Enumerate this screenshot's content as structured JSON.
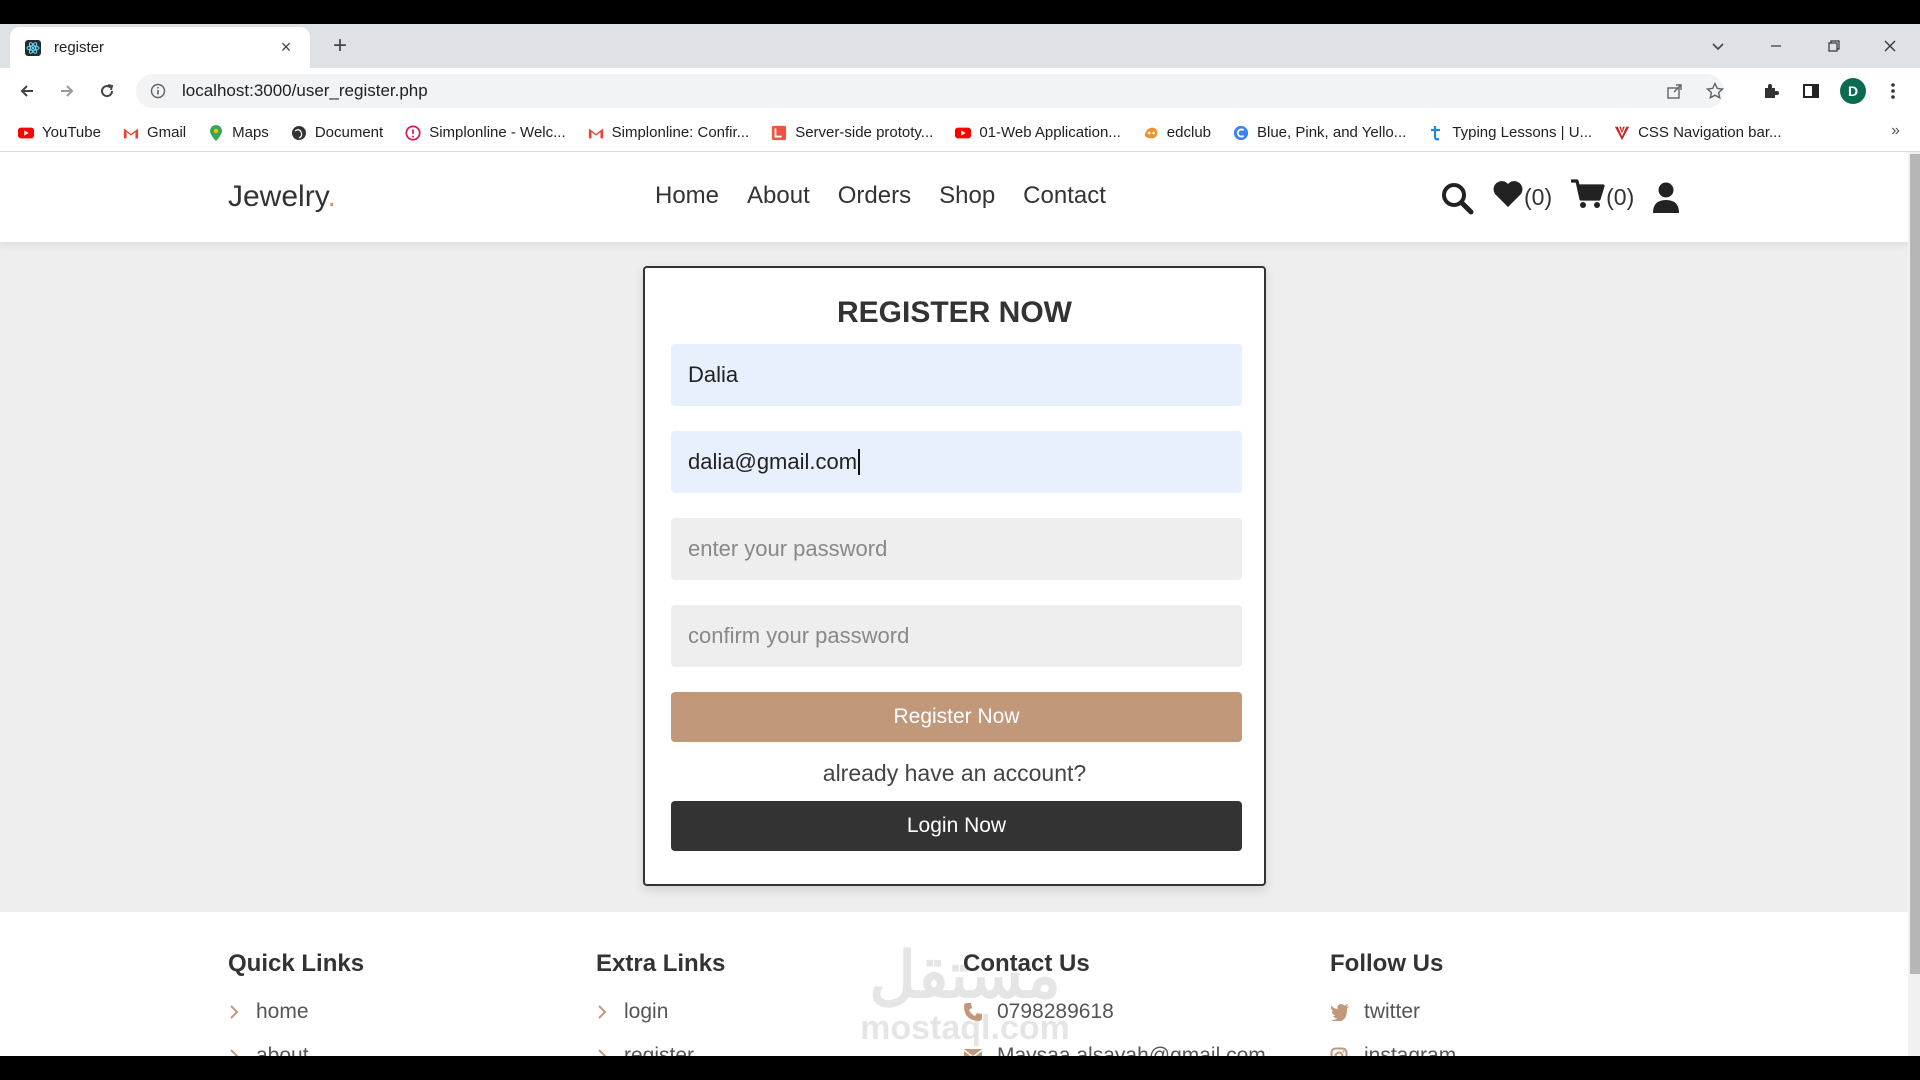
{
  "browser": {
    "tab_title": "register",
    "tab_close": "×",
    "new_tab": "+",
    "url": "localhost:3000/user_register.php",
    "profile_initial": "D",
    "bookmarks": [
      {
        "label": "YouTube",
        "icon": "youtube-icon",
        "color": "#ff0000"
      },
      {
        "label": "Gmail",
        "icon": "gmail-icon",
        "color": "#ea4335"
      },
      {
        "label": "Maps",
        "icon": "maps-icon",
        "color": "#34a853"
      },
      {
        "label": "Document",
        "icon": "globe-icon",
        "color": "#333333"
      },
      {
        "label": "Simplonline - Welc...",
        "icon": "simplon-icon",
        "color": "#d81b60"
      },
      {
        "label": "Simplonline: Confir...",
        "icon": "gmail-icon",
        "color": "#ea4335"
      },
      {
        "label": "Server-side prototy...",
        "icon": "laravel-icon",
        "color": "#f05340"
      },
      {
        "label": "01-Web Application...",
        "icon": "youtube-icon",
        "color": "#ff0000"
      },
      {
        "label": "edclub",
        "icon": "edclub-icon",
        "color": "#f0932b"
      },
      {
        "label": "Blue, Pink, and Yello...",
        "icon": "canva-icon",
        "color": "#3b82f6"
      },
      {
        "label": "Typing Lessons | U...",
        "icon": "typing-icon",
        "color": "#1e88e5"
      },
      {
        "label": "CSS Navigation bar...",
        "icon": "vivaldi-icon",
        "color": "#c62828"
      }
    ],
    "bookmarks_more": "»"
  },
  "site": {
    "logo_text": "Jewelry",
    "logo_dot": ".",
    "nav": [
      "Home",
      "About",
      "Orders",
      "Shop",
      "Contact"
    ],
    "wishlist_count": "(0)",
    "cart_count": "(0)",
    "accent": "#c2987b"
  },
  "form": {
    "title": "REGISTER NOW",
    "name_value": "Dalia",
    "email_value": "dalia@gmail.com",
    "password_placeholder": "enter your password",
    "confirm_placeholder": "confirm your password",
    "register_label": "Register Now",
    "already_text": "already have an account?",
    "login_label": "Login Now"
  },
  "footer": {
    "quick_links": {
      "title": "Quick Links",
      "items": [
        "home",
        "about"
      ]
    },
    "extra_links": {
      "title": "Extra Links",
      "items": [
        "login",
        "register"
      ]
    },
    "contact": {
      "title": "Contact Us",
      "phone": "0798289618",
      "email": "Maysaa.alsayah@gmail.com"
    },
    "follow": {
      "title": "Follow Us",
      "items": [
        "twitter",
        "instagram"
      ]
    },
    "watermark_ar": "مستقل",
    "watermark_en": "mostaql.com"
  }
}
